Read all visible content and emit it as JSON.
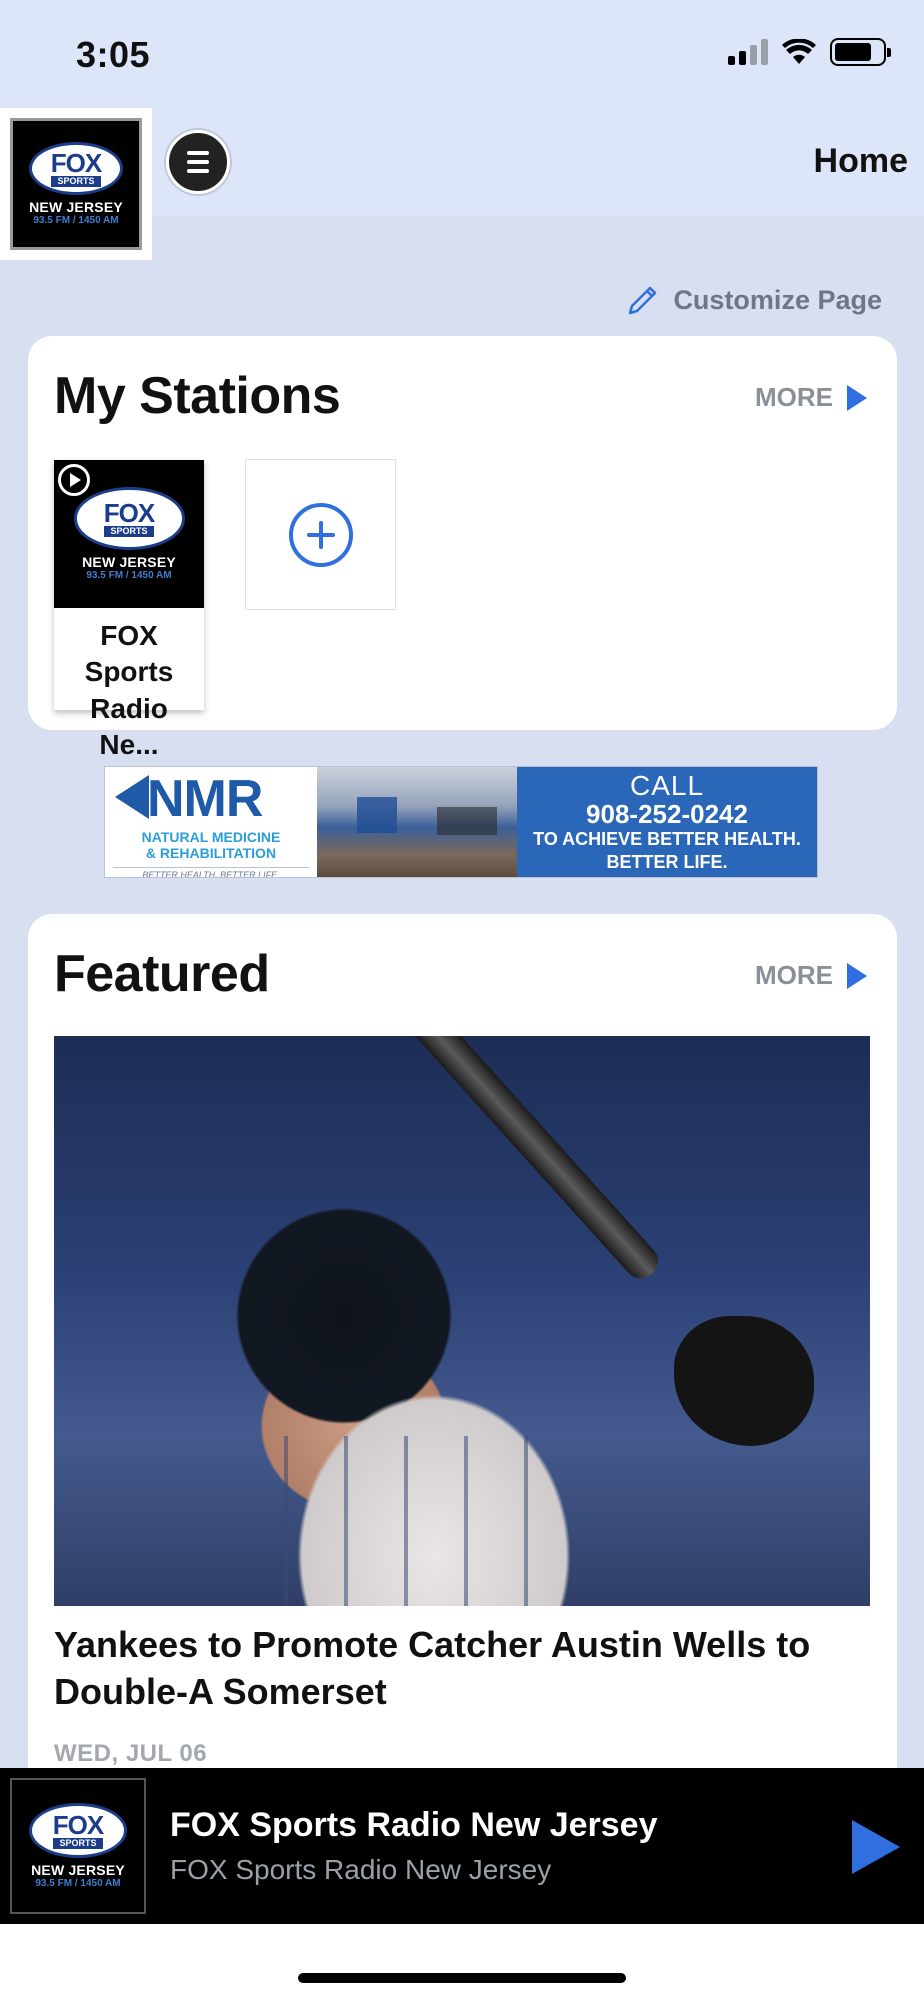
{
  "status_bar": {
    "time": "3:05"
  },
  "header": {
    "title": "Home",
    "logo": {
      "brand": "FOX",
      "sub": "SPORTS",
      "region": "NEW JERSEY",
      "frequency": "93.5 FM / 1450 AM"
    }
  },
  "customize": {
    "label": "Customize Page"
  },
  "my_stations": {
    "title": "My Stations",
    "more_label": "MORE",
    "stations": [
      {
        "name": "FOX Sports Radio Ne..."
      }
    ]
  },
  "ad": {
    "brand": "NMR",
    "subtitle_line1": "NATURAL MEDICINE",
    "subtitle_line2": "& REHABILITATION",
    "tagline": "BETTER HEALTH. BETTER LIFE.",
    "call": "CALL",
    "phone": "908-252-0242",
    "line1": "TO ACHIEVE BETTER HEALTH.",
    "line2": "BETTER LIFE."
  },
  "featured": {
    "title": "Featured",
    "more_label": "MORE",
    "headline": "Yankees to Promote Catcher Austin Wells to Double-A Somerset",
    "date": "WED, JUL 06"
  },
  "player": {
    "title": "FOX Sports Radio New Jersey",
    "subtitle": "FOX Sports Radio New Jersey"
  },
  "colors": {
    "accent": "#2f6fe0",
    "background": "#d7dff0",
    "header": "#dde6f8"
  }
}
